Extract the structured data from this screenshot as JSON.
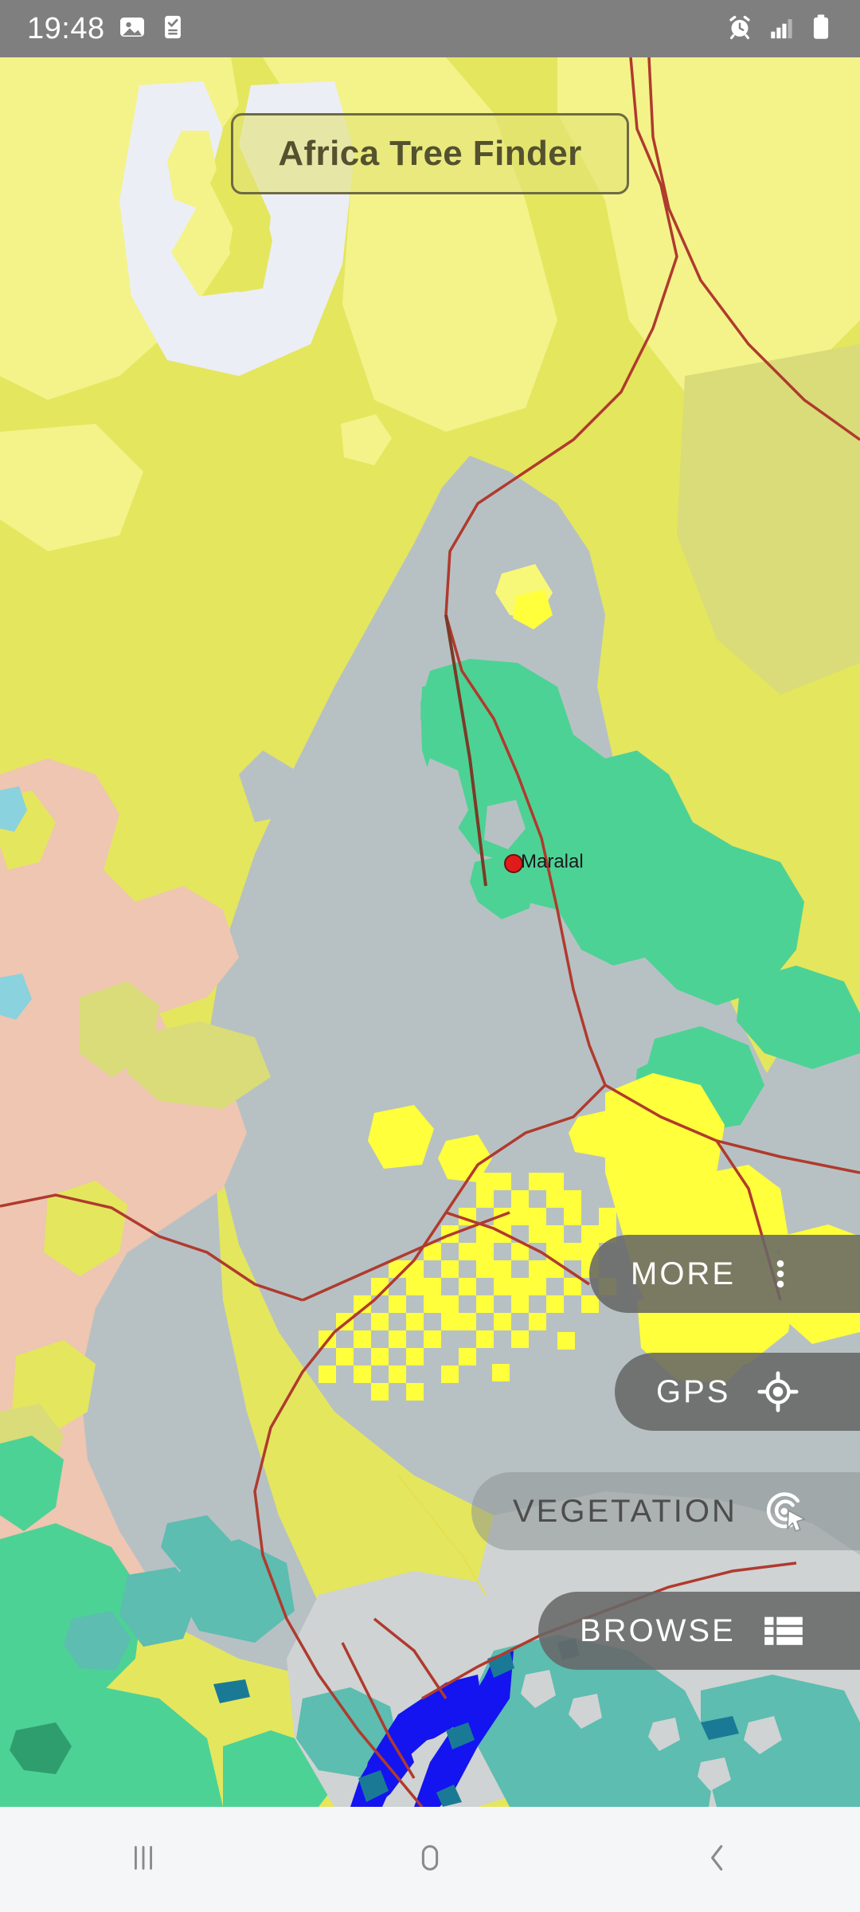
{
  "status_bar": {
    "time": "19:48",
    "left_icons": [
      {
        "name": "gallery-image-icon"
      },
      {
        "name": "phone-check-icon"
      }
    ],
    "right_icons": [
      {
        "name": "alarm-clock-icon"
      },
      {
        "name": "signal-bars-icon",
        "bars_filled": 3,
        "bars_total": 4
      },
      {
        "name": "battery-full-icon"
      }
    ]
  },
  "app": {
    "title": "Africa Tree Finder"
  },
  "map": {
    "place_labels": [
      {
        "name": "Maralal"
      }
    ],
    "colors": {
      "base_yellow": "#e4e65e",
      "light_yellow": "#f3f38a",
      "bright_yellow": "#ffff3c",
      "pale_lavender": "#eceef5",
      "olive_yellow": "#d9dc78",
      "gray_blue": "#b7c1c3",
      "light_gray": "#cfd3d3",
      "green": "#4dd295",
      "teal": "#5cbdb0",
      "dark_teal": "#1a7a96",
      "blue_water": "#1414f0",
      "cyan_lake": "#8ad2dd",
      "salmon": "#eec6b1",
      "purple": "#7a14f0",
      "road_red": "#c0392b",
      "road_brown": "#7a3b26",
      "marker_red": "#e01b1b"
    }
  },
  "buttons": [
    {
      "id": "more",
      "label": "MORE",
      "icon": "overflow-menu-icon",
      "enabled": true
    },
    {
      "id": "gps",
      "label": "GPS",
      "icon": "gps-target-icon",
      "enabled": true
    },
    {
      "id": "vegetation",
      "label": "VEGETATION",
      "icon": "tap-select-icon",
      "enabled": false
    },
    {
      "id": "browse",
      "label": "BROWSE",
      "icon": "list-view-icon",
      "enabled": true
    }
  ],
  "nav_bar": {
    "items": [
      {
        "name": "recents-button",
        "icon": "recents-icon"
      },
      {
        "name": "home-button",
        "icon": "home-icon"
      },
      {
        "name": "back-button",
        "icon": "back-chevron-icon"
      }
    ]
  }
}
